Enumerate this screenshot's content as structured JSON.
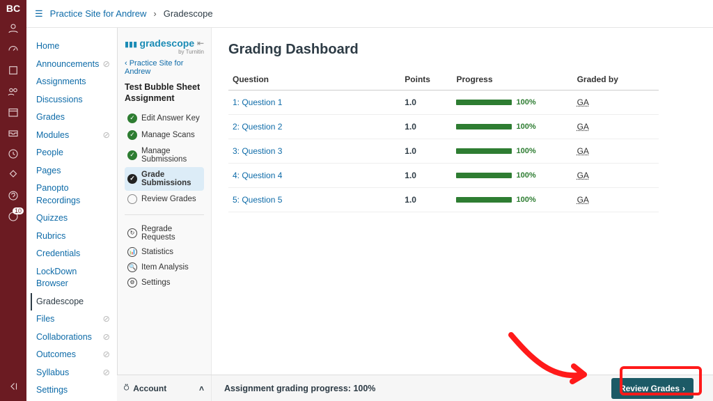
{
  "topbar": {
    "site": "Practice Site for Andrew",
    "page": "Gradescope"
  },
  "rail": {
    "badge_count": "10"
  },
  "canvas_nav": [
    {
      "label": "Home",
      "hidden": false
    },
    {
      "label": "Announcements",
      "hidden": true
    },
    {
      "label": "Assignments",
      "hidden": false
    },
    {
      "label": "Discussions",
      "hidden": false
    },
    {
      "label": "Grades",
      "hidden": false
    },
    {
      "label": "Modules",
      "hidden": true
    },
    {
      "label": "People",
      "hidden": false
    },
    {
      "label": "Pages",
      "hidden": false
    },
    {
      "label": "Panopto Recordings",
      "hidden": false
    },
    {
      "label": "Quizzes",
      "hidden": false
    },
    {
      "label": "Rubrics",
      "hidden": false
    },
    {
      "label": "Credentials",
      "hidden": false
    },
    {
      "label": "LockDown Browser",
      "hidden": false
    },
    {
      "label": "Gradescope",
      "hidden": false,
      "active": true
    },
    {
      "label": "Files",
      "hidden": true
    },
    {
      "label": "Collaborations",
      "hidden": true
    },
    {
      "label": "Outcomes",
      "hidden": true
    },
    {
      "label": "Syllabus",
      "hidden": true
    },
    {
      "label": "Settings",
      "hidden": false
    }
  ],
  "gs": {
    "brand": "gradescope",
    "brand_sub": "by Turnitin",
    "back": "‹ Practice Site for Andrew",
    "assignment_title": "Test Bubble Sheet Assignment",
    "steps": [
      {
        "label": "Edit Answer Key",
        "state": "ok"
      },
      {
        "label": "Manage Scans",
        "state": "ok"
      },
      {
        "label": "Manage Submissions",
        "state": "ok"
      },
      {
        "label": "Grade Submissions",
        "state": "cur"
      },
      {
        "label": "Review Grades",
        "state": "empty"
      }
    ],
    "utils": [
      {
        "label": "Regrade Requests",
        "glyph": "↻"
      },
      {
        "label": "Statistics",
        "glyph": "📊"
      },
      {
        "label": "Item Analysis",
        "glyph": "🔍"
      },
      {
        "label": "Settings",
        "glyph": "⚙"
      }
    ]
  },
  "main": {
    "title": "Grading Dashboard",
    "cols": {
      "q": "Question",
      "pts": "Points",
      "prog": "Progress",
      "by": "Graded by"
    },
    "rows": [
      {
        "q": "1: Question 1",
        "pts": "1.0",
        "pct": "100%",
        "by": "GA"
      },
      {
        "q": "2: Question 2",
        "pts": "1.0",
        "pct": "100%",
        "by": "GA"
      },
      {
        "q": "3: Question 3",
        "pts": "1.0",
        "pct": "100%",
        "by": "GA"
      },
      {
        "q": "4: Question 4",
        "pts": "1.0",
        "pct": "100%",
        "by": "GA"
      },
      {
        "q": "5: Question 5",
        "pts": "1.0",
        "pct": "100%",
        "by": "GA"
      }
    ]
  },
  "footer": {
    "account": "Account",
    "progress": "Assignment grading progress: 100%",
    "review": "Review Grades"
  }
}
